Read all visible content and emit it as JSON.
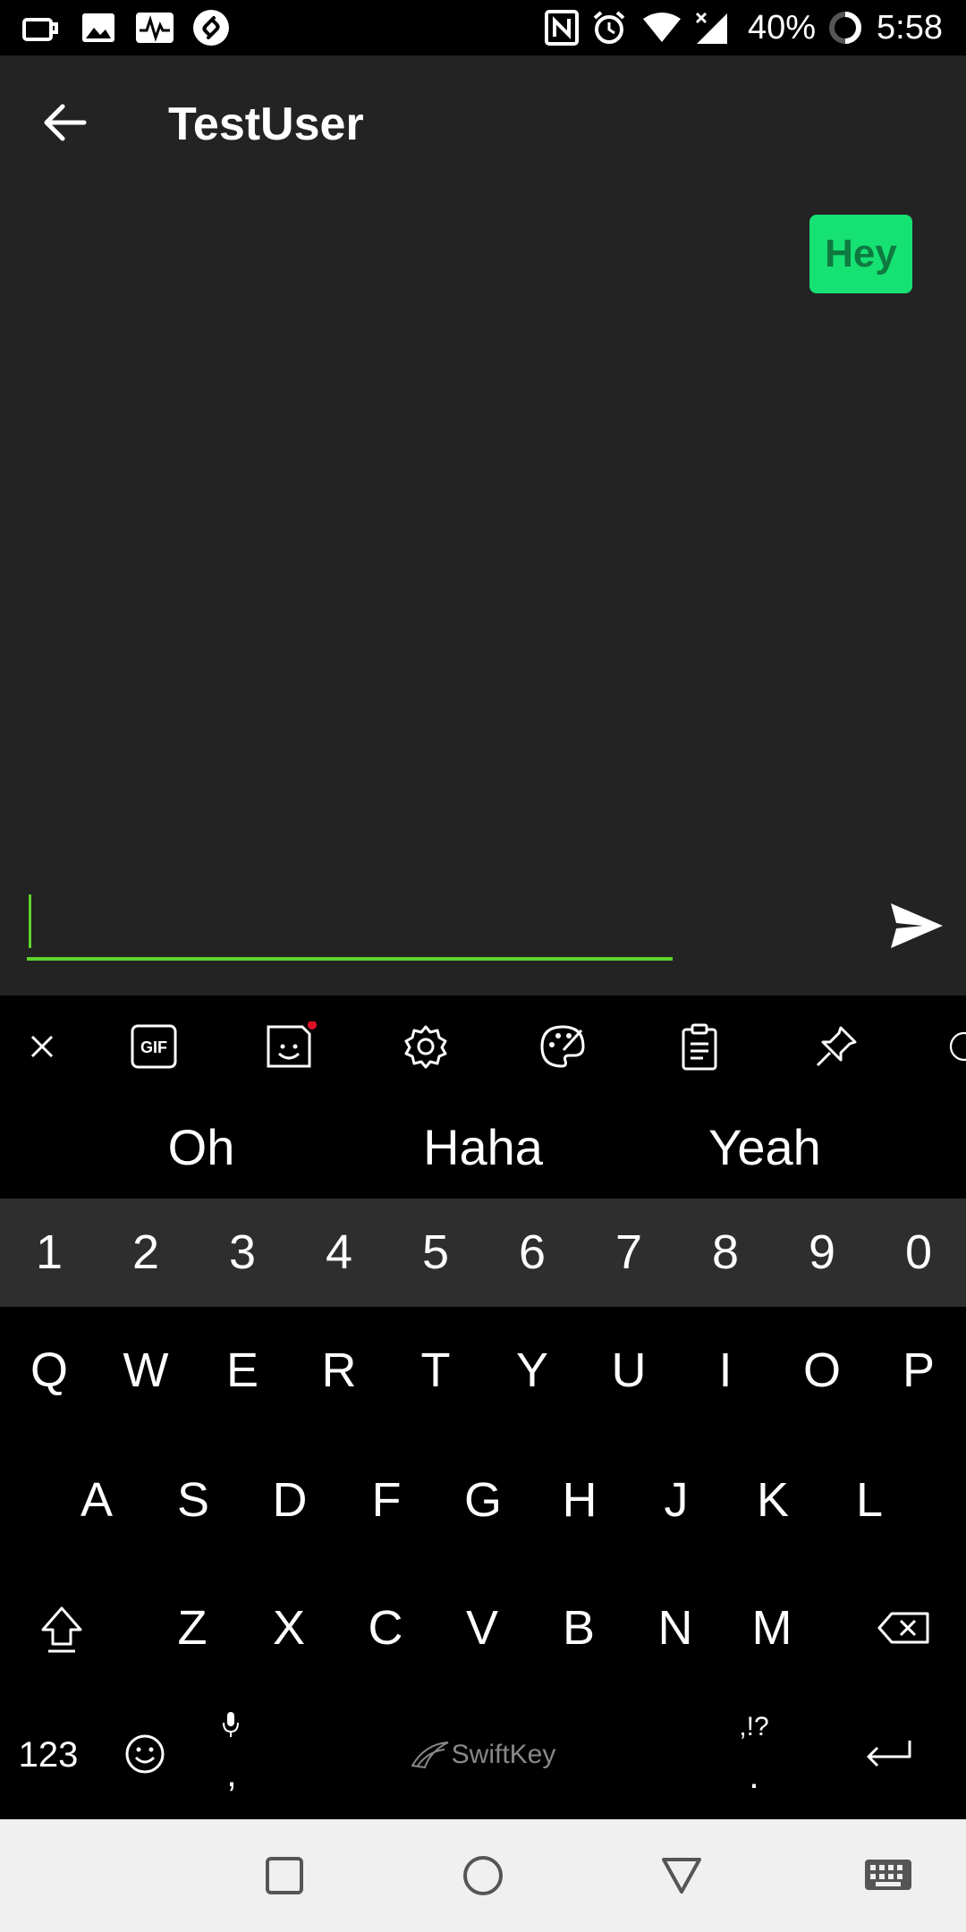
{
  "status_bar": {
    "battery_percent": "40%",
    "time": "5:58",
    "left_icons": [
      "cup-icon",
      "gallery-icon",
      "activity-icon",
      "shazam-icon"
    ],
    "right_icons": [
      "nfc-icon",
      "alarm-icon",
      "wifi-icon",
      "signal-icon",
      "battery-saver-icon"
    ]
  },
  "app_bar": {
    "title": "TestUser"
  },
  "chat": {
    "messages": [
      {
        "text": "Hey",
        "direction": "outgoing",
        "color": "#16e173"
      }
    ],
    "input": {
      "value": "",
      "placeholder": ""
    }
  },
  "keyboard": {
    "toolbar_icons": [
      "close-icon",
      "gif-icon",
      "sticker-icon",
      "settings-icon",
      "theme-icon",
      "clipboard-icon",
      "pin-icon",
      "more-icon"
    ],
    "suggestions": [
      "Oh",
      "Haha",
      "Yeah"
    ],
    "number_row": [
      "1",
      "2",
      "3",
      "4",
      "5",
      "6",
      "7",
      "8",
      "9",
      "0"
    ],
    "row1": [
      "Q",
      "W",
      "E",
      "R",
      "T",
      "Y",
      "U",
      "I",
      "O",
      "P"
    ],
    "row2": [
      "A",
      "S",
      "D",
      "F",
      "G",
      "H",
      "J",
      "K",
      "L"
    ],
    "row3": [
      "Z",
      "X",
      "C",
      "V",
      "B",
      "N",
      "M"
    ],
    "bottom": {
      "numbers_label": "123",
      "comma_label": ",",
      "brand_label": "SwiftKey",
      "punct_label": ",!?",
      "period_label": "."
    }
  },
  "colors": {
    "accent": "#5cd42c",
    "bubble": "#16e173",
    "background": "#232323"
  }
}
